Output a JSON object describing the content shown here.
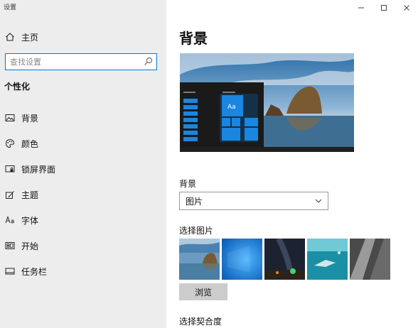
{
  "window": {
    "title": "设置",
    "controls": [
      {
        "name": "minimize",
        "icon": "minimize-icon"
      },
      {
        "name": "maximize",
        "icon": "maximize-icon"
      },
      {
        "name": "close",
        "icon": "close-icon"
      }
    ]
  },
  "sidebar": {
    "home_label": "主页",
    "search_placeholder": "查找设置",
    "section_heading": "个性化",
    "items": [
      {
        "label": "背景",
        "icon": "picture-icon"
      },
      {
        "label": "颜色",
        "icon": "palette-icon"
      },
      {
        "label": "锁屏界面",
        "icon": "lock-screen-icon"
      },
      {
        "label": "主题",
        "icon": "theme-brush-icon"
      },
      {
        "label": "字体",
        "icon": "font-icon"
      },
      {
        "label": "开始",
        "icon": "start-menu-icon"
      },
      {
        "label": "任务栏",
        "icon": "taskbar-icon"
      }
    ]
  },
  "main": {
    "title": "背景",
    "preview_tile_text": "Aa",
    "background_label": "背景",
    "background_value": "图片",
    "choose_picture_label": "选择图片",
    "browse_button": "浏览",
    "choose_fit_label": "选择契合度"
  },
  "colors": {
    "accent": "#0078d7",
    "sidebar_bg": "#ededed"
  }
}
